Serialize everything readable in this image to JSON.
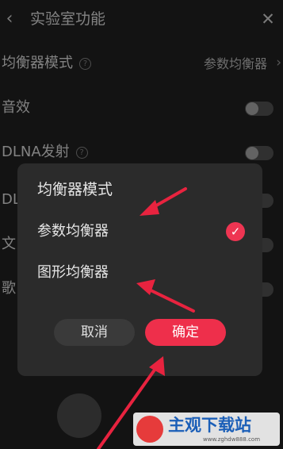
{
  "header": {
    "back_icon": "‹",
    "title": "实验室功能",
    "close_icon": "✕"
  },
  "settings": {
    "equalizer_mode": {
      "label": "均衡器模式",
      "value": "参数均衡器",
      "help": "?"
    },
    "sound_effect": {
      "label": "音效"
    },
    "dlna": {
      "label": "DLNA发射",
      "help": "?"
    },
    "row4": {
      "label": "DL"
    },
    "row5": {
      "label": "文"
    },
    "row6": {
      "label": "歌"
    }
  },
  "dialog": {
    "title": "均衡器模式",
    "options": [
      {
        "label": "参数均衡器",
        "selected": true
      },
      {
        "label": "图形均衡器",
        "selected": false
      }
    ],
    "cancel_label": "取消",
    "confirm_label": "确定"
  },
  "colors": {
    "accent": "#ee2f4b",
    "arrow": "#e8233f"
  },
  "watermark": {
    "text": "主观下载站",
    "url": "www.zghdw888.com"
  }
}
